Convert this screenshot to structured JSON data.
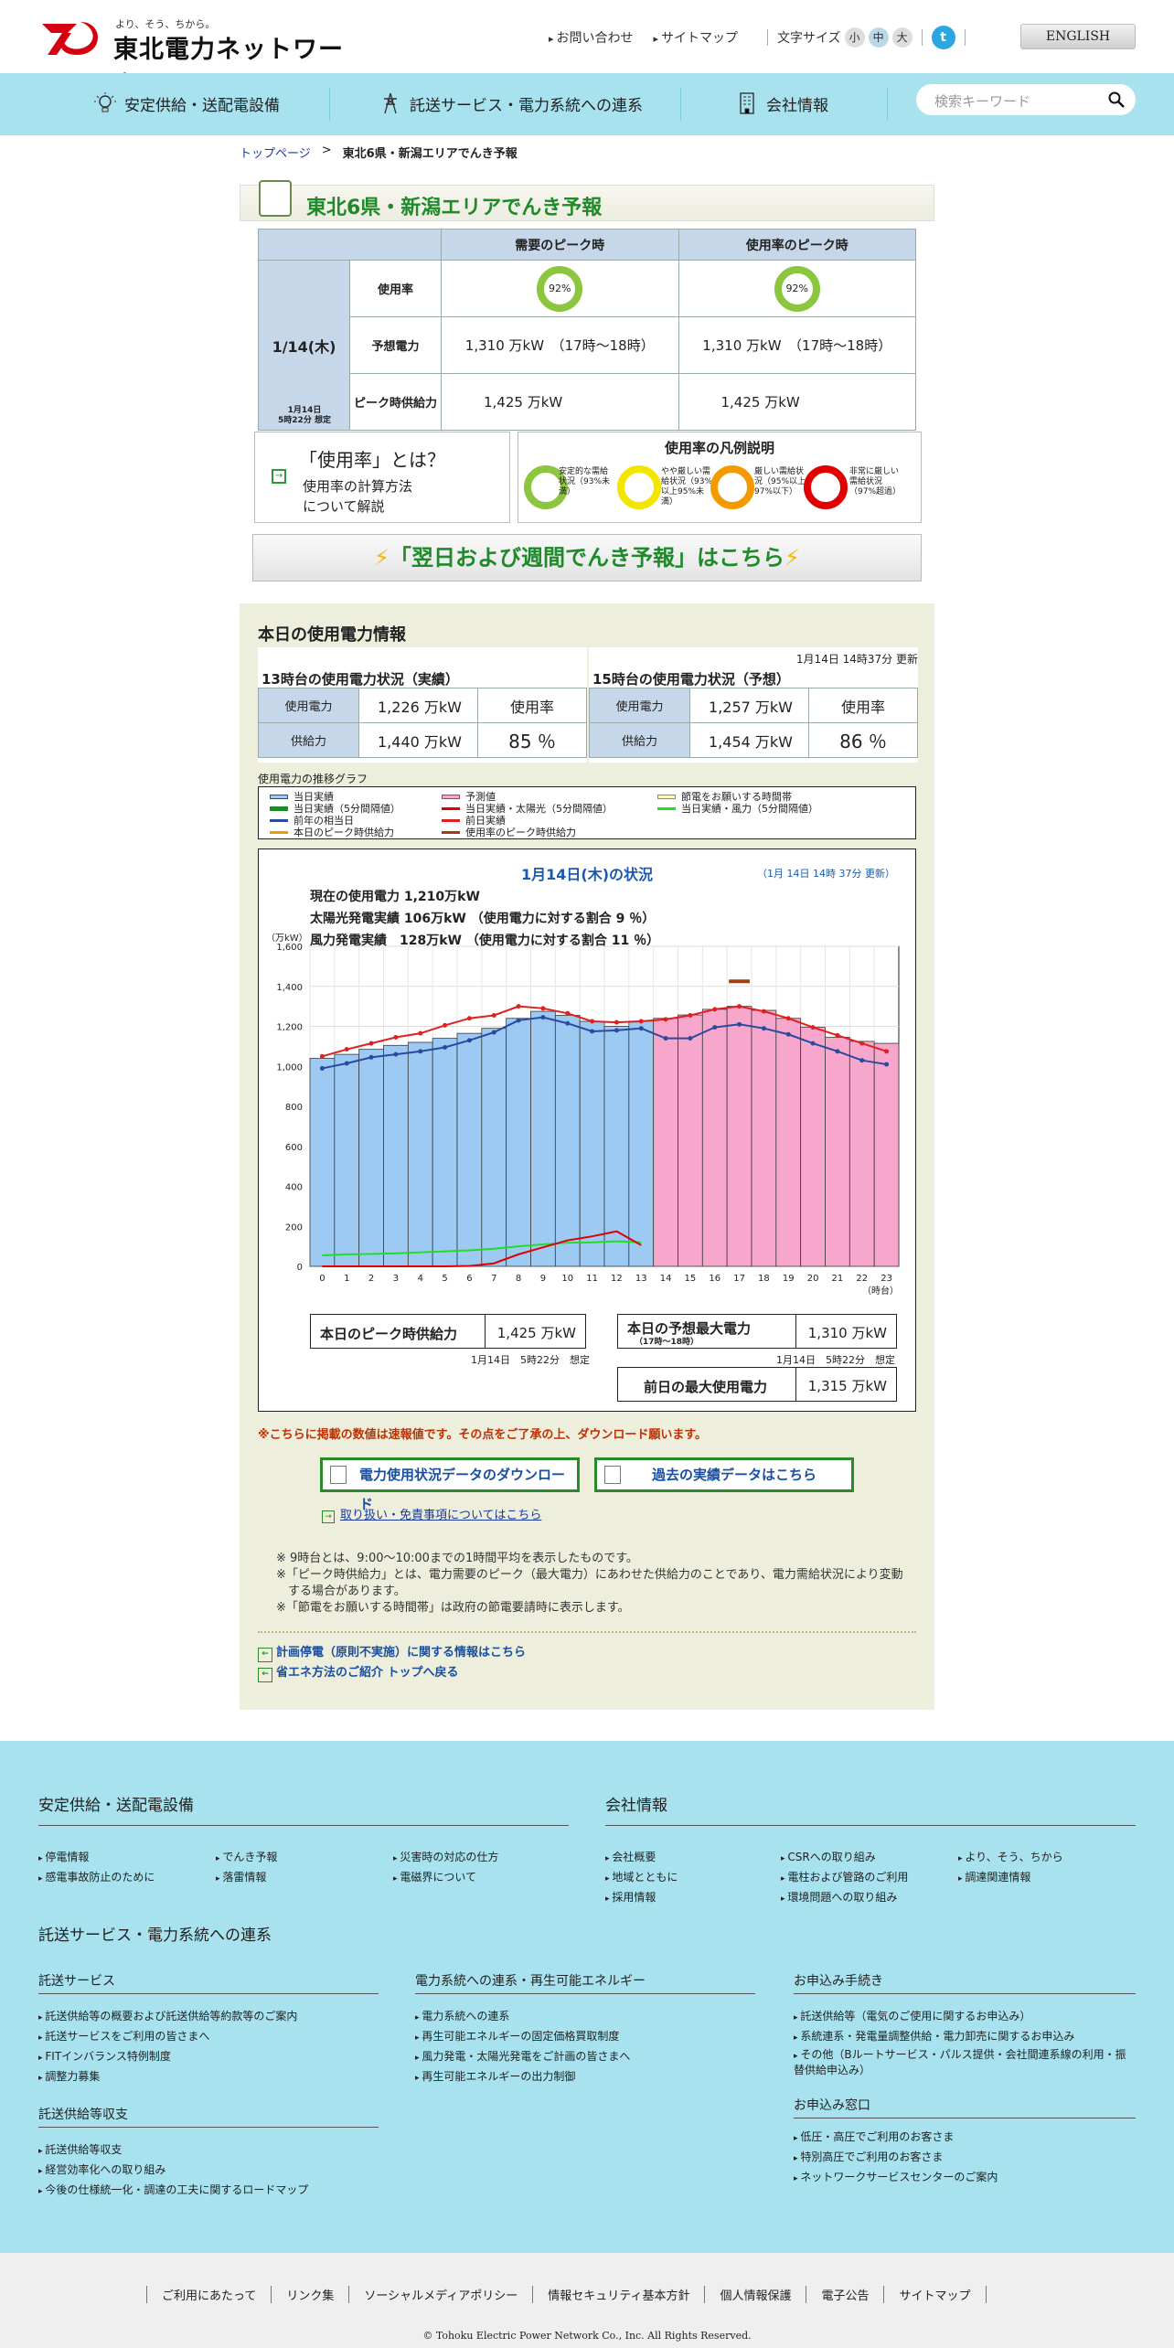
{
  "header": {
    "tagline": "より、そう、ちから。",
    "brand": "東北電力ネットワーク",
    "links": [
      "お問い合わせ",
      "サイトマップ"
    ],
    "font_size_label": "文字サイズ",
    "font_sizes": [
      "小",
      "中",
      "大"
    ],
    "english": "ENGLISH"
  },
  "nav": {
    "items": [
      "安定供給・送配電設備",
      "託送サービス・電力系統への連系",
      "会社情報"
    ],
    "search_placeholder": "検索キーワード"
  },
  "breadcrumb": {
    "home": "トップページ",
    "sep": ">",
    "current": "東北6県・新潟エリアでんき予報"
  },
  "title": "東北6県・新潟エリアでんき予報",
  "forecast": {
    "col_demand": "需要のピーク時",
    "col_usage": "使用率のピーク時",
    "day": "1/14(木)",
    "stamp1": "1月14日",
    "stamp2": "5時22分 想定",
    "row_usage": "使用率",
    "row_pred": "予想電力",
    "row_supply": "ピーク時供給力",
    "usage1": "92%",
    "usage2": "92%",
    "pred1": "1,310 万kW　（17時～18時）",
    "pred2": "1,310 万kW　（17時～18時）",
    "supply1": "1,425 万kW",
    "supply2": "1,425 万kW"
  },
  "explain": {
    "title": "「使用率」とは？",
    "line1": "使用率の計算方法",
    "line2": "について解説"
  },
  "legend_box": {
    "title": "使用率の凡例説明",
    "items": [
      {
        "t": "安定的な需給状況（93%未満）",
        "color": "#8cc63e"
      },
      {
        "t": "やや厳しい需給状況（93%以上95%未満）",
        "color": "#f2e600"
      },
      {
        "t": "厳しい需給状況（95%以上97%以下）",
        "color": "#f29a00"
      },
      {
        "t": "非常に厳しい需給状況（97%超過）",
        "color": "#e00000"
      }
    ]
  },
  "banner": "「翌日および週間でんき予報」はこちら",
  "today": {
    "heading": "本日の使用電力情報",
    "actual": {
      "title": "13時台の使用電力状況（実績）",
      "k_use": "使用電力",
      "v_use": "1,226 万kW",
      "k_sup": "供給力",
      "v_sup": "1,440 万kW",
      "k_rate": "使用率",
      "v_rate": "85 ％"
    },
    "forecast": {
      "updated": "1月14日 14時37分 更新",
      "title": "15時台の使用電力状況（予想）",
      "k_use": "使用電力",
      "v_use": "1,257 万kW",
      "k_sup": "供給力",
      "v_sup": "1,454 万kW",
      "k_rate": "使用率",
      "v_rate": "86 ％"
    },
    "graph_label": "使用電力の推移グラフ",
    "legend": [
      "当日実績",
      "当日実績（5分間隔値）",
      "前年の相当日",
      "本日のピーク時供給力",
      "予測値",
      "当日実績・太陽光（5分間隔値）",
      "前日実績",
      "使用率のピーク時供給力",
      "節電をお願いする時間帯",
      "当日実績・風力（5分間隔値）"
    ],
    "warn": "※こちらに掲載の数値は速報値です。その点をご了承の上、ダウンロード願います。",
    "btn_download": "電力使用状況データのダウンロード",
    "btn_past": "過去の実績データはこちら",
    "note_link": "取り扱い・免責事項についてはこちら",
    "notes": [
      "※ 9時台とは、9:00～10:00までの1時間平均を表示したものです。",
      "※「ピーク時供給力」とは、電力需要のピーク（最大電力）にあわせた供給力のことであり、電力需給状況により変動",
      "　する場合があります。",
      "※「節電をお願いする時間帯」は政府の節電要請時に表示します。"
    ],
    "bottom_links": [
      "計画停電（原則不実施）に関する情報はこちら",
      "省エネ方法のご紹介 トップへ戻る"
    ]
  },
  "chart_data": {
    "type": "bar",
    "title": "1月14日(木)の状況",
    "updated": "（1月 14日 14時 37分 更新）",
    "info": [
      "現在の使用電力 1,210万kW",
      "太陽光発電実績 106万kW （使用電力に対する割合 9 ％）",
      "風力発電実績　128万kW （使用電力に対する割合 11 ％）"
    ],
    "ylabel": "（万kW）",
    "xlabel": "（時台）",
    "ylim": [
      0,
      1600
    ],
    "yticks": [
      0,
      200,
      400,
      600,
      800,
      1000,
      1200,
      1400,
      1600
    ],
    "categories": [
      "0",
      "1",
      "2",
      "3",
      "4",
      "5",
      "6",
      "7",
      "8",
      "9",
      "10",
      "11",
      "12",
      "13",
      "14",
      "15",
      "16",
      "17",
      "18",
      "19",
      "20",
      "21",
      "22",
      "23"
    ],
    "series": [
      {
        "name": "当日実績",
        "values": [
          1040,
          1060,
          1085,
          1105,
          1120,
          1140,
          1165,
          1190,
          1240,
          1275,
          1255,
          1225,
          1200,
          1226,
          null,
          null,
          null,
          null,
          null,
          null,
          null,
          null,
          null,
          null
        ],
        "color": "#9ccaf3"
      },
      {
        "name": "予測値",
        "values": [
          null,
          null,
          null,
          null,
          null,
          null,
          null,
          null,
          null,
          null,
          null,
          null,
          null,
          null,
          1240,
          1257,
          1285,
          1300,
          1280,
          1240,
          1195,
          1145,
          1125,
          1115
        ],
        "color": "#f7a6cc"
      },
      {
        "name": "前年の相当日",
        "values": [
          990,
          1015,
          1045,
          1060,
          1075,
          1095,
          1130,
          1170,
          1230,
          1245,
          1215,
          1175,
          1180,
          1190,
          1140,
          1140,
          1195,
          1210,
          1190,
          1160,
          1115,
          1075,
          1030,
          1010
        ],
        "color": "#2a4aa0"
      },
      {
        "name": "前日実績",
        "values": [
          1050,
          1085,
          1115,
          1145,
          1165,
          1205,
          1240,
          1255,
          1300,
          1290,
          1265,
          1225,
          1220,
          1225,
          1235,
          1255,
          1285,
          1300,
          1275,
          1240,
          1195,
          1155,
          1115,
          1075
        ],
        "color": "#e02020"
      },
      {
        "name": "当日実績・風力（5分間隔値）",
        "values": [
          55,
          60,
          62,
          65,
          70,
          75,
          80,
          88,
          100,
          110,
          118,
          120,
          125,
          120,
          null,
          null,
          null,
          null,
          null,
          null,
          null,
          null,
          null,
          null
        ],
        "color": "#22dd22"
      },
      {
        "name": "当日実績・太陽光（5分間隔値）",
        "values": [
          0,
          0,
          0,
          0,
          0,
          0,
          2,
          15,
          60,
          95,
          130,
          150,
          175,
          106,
          null,
          null,
          null,
          null,
          null,
          null,
          null,
          null,
          null,
          null
        ],
        "color": "#e00000"
      }
    ],
    "peak_supply_marker": {
      "category": "17",
      "value": 1425,
      "color": "#a04010"
    },
    "peak_supply": "1,425 万kW",
    "peak_supply_label": "本日のピーク時供給力",
    "peak_supply_stamp": "1月14日　5時22分　想定",
    "pred_max_label": "本日の予想最大電力",
    "pred_max_sub": "（17時～18時）",
    "pred_max": "1,310 万kW",
    "pred_max_stamp": "1月14日　5時22分　想定",
    "prev_max_label": "前日の最大使用電力",
    "prev_max": "1,315 万kW"
  },
  "footer": {
    "sec1": "安定供給・送配電設備",
    "sec1_items": [
      "停電情報",
      "感電事故防止のために",
      "でんき予報",
      "落雷情報",
      "災害時の対応の仕方",
      "電磁界について"
    ],
    "sec2": "会社情報",
    "sec2_items": [
      "会社概要",
      "地域とともに",
      "採用情報",
      "CSRへの取り組み",
      "電柱および管路のご利用",
      "環境問題への取り組み",
      "より、そう、ちから",
      "調達関連情報"
    ],
    "sec3": "託送サービス・電力系統への連系",
    "sub1": "託送サービス",
    "sub1_items": [
      "託送供給等の概要および託送供給等約款等のご案内",
      "託送サービスをご利用の皆さまへ",
      "FITインバランス特例制度",
      "調整力募集"
    ],
    "sub2": "託送供給等収支",
    "sub2_items": [
      "託送供給等収支",
      "経営効率化への取り組み",
      "今後の仕様統一化・調達の工夫に関するロードマップ"
    ],
    "sub3": "電力系統への連系・再生可能エネルギー",
    "sub3_items": [
      "電力系統への連系",
      "再生可能エネルギーの固定価格買取制度",
      "風力発電・太陽光発電をご計画の皆さまへ",
      "再生可能エネルギーの出力制御"
    ],
    "sub4": "お申込み手続き",
    "sub4_items": [
      "託送供給等（電気のご使用に関するお申込み）",
      "系統連系・発電量調整供給・電力卸売に関するお申込み",
      "その他（Bルートサービス・パルス提供・会社間連系線の利用・振替供給申込み）"
    ],
    "sub5": "お申込み窓口",
    "sub5_items": [
      "低圧・高圧でご利用のお客さま",
      "特別高圧でご利用のお客さま",
      "ネットワークサービスセンターのご案内"
    ],
    "bottom": [
      "ご利用にあたって",
      "リンク集",
      "ソーシャルメディアポリシー",
      "情報セキュリティ基本方針",
      "個人情報保護",
      "電子公告",
      "サイトマップ"
    ],
    "copyright": "© Tohoku Electric Power Network Co., Inc. All Rights Reserved."
  }
}
